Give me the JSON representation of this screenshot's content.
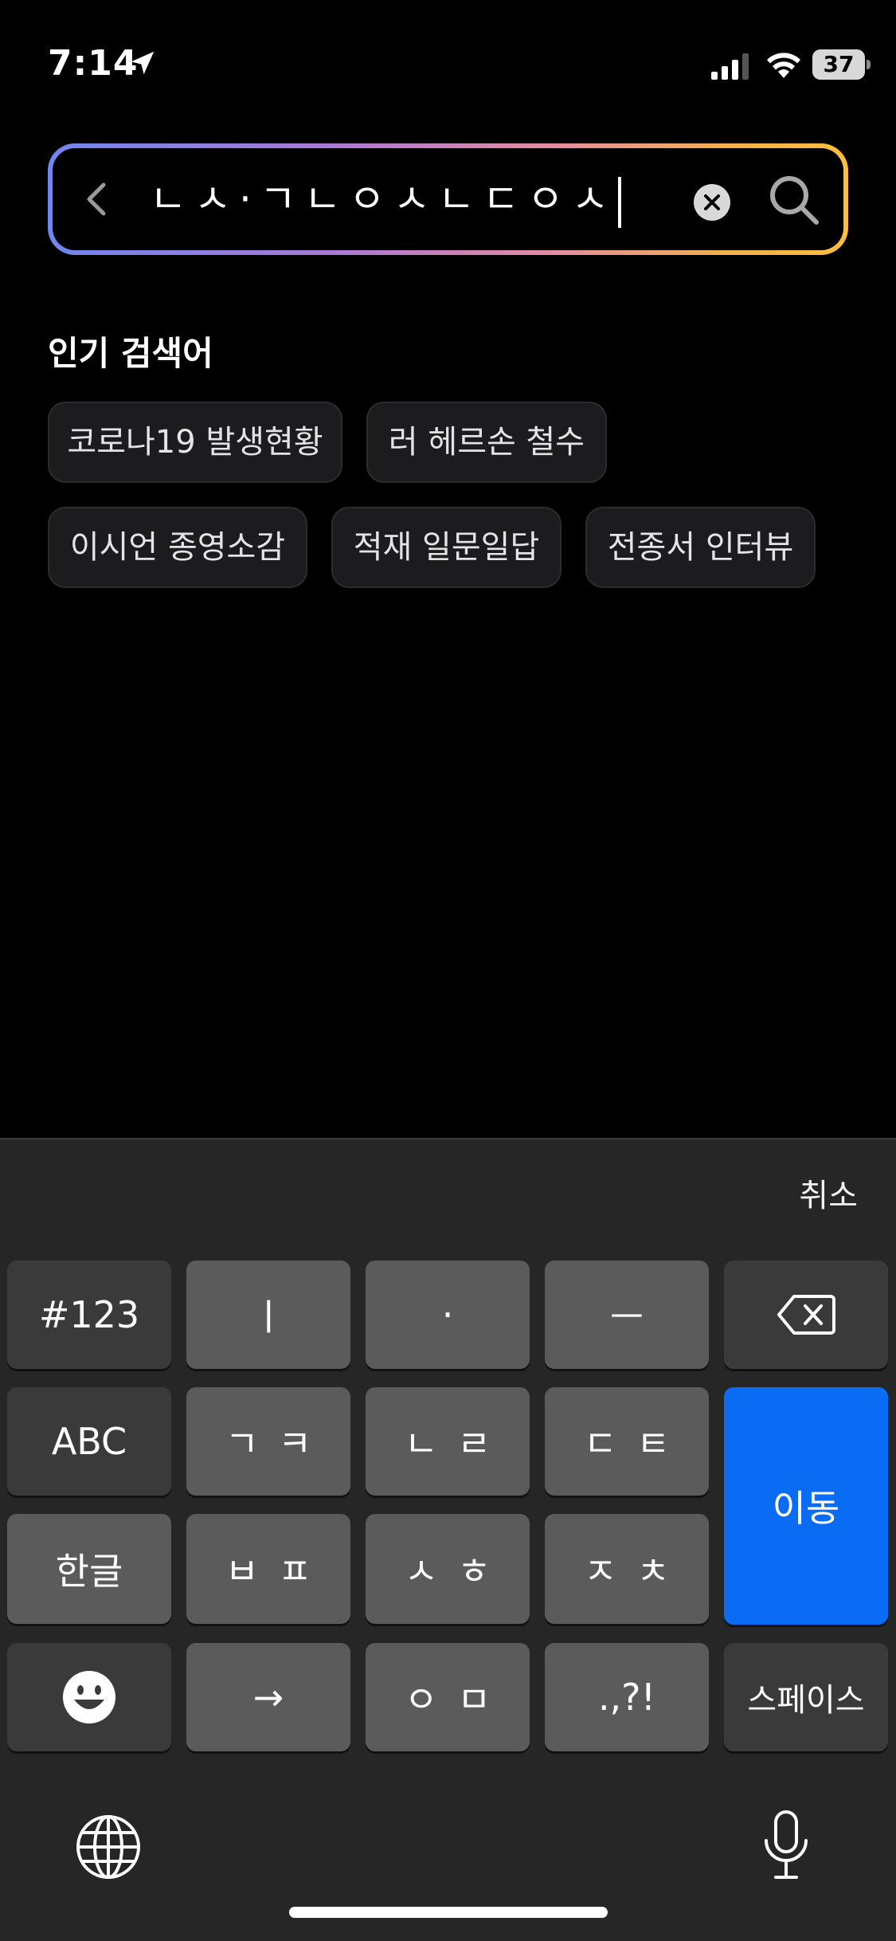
{
  "status_bar": {
    "time": "7:14",
    "battery": "37"
  },
  "search": {
    "query": "ㄴㅅ·ㄱㄴㅇㅅㄴㄷㅇㅅ"
  },
  "popular": {
    "title": "인기 검색어",
    "chips": [
      "코로나19 발생현황",
      "러 헤르손 철수",
      "이시언 종영소감",
      "적재 일문일답",
      "전종서 인터뷰"
    ]
  },
  "keyboard": {
    "cancel_label": "취소",
    "keys": {
      "num": "#123",
      "k_vowel1": "ㅣ",
      "k_vowel2": "·",
      "k_vowel3": "ㅡ",
      "abc": "ABC",
      "k_gk": "ㄱㅋ",
      "k_nr": "ㄴㄹ",
      "k_dt": "ㄷㅌ",
      "enter": "이동",
      "hangul": "한글",
      "k_bp": "ㅂㅍ",
      "k_sh": "ㅅㅎ",
      "k_jc": "ㅈㅊ",
      "arrow": "→",
      "k_om": "ㅇㅁ",
      "punct": ".,?!",
      "space": "스페이스"
    }
  },
  "colors": {
    "gradient": [
      "#6f86ee",
      "#a978d6",
      "#e48aa4",
      "#fdbe3c"
    ],
    "enter_key": "#0a6cf5"
  }
}
